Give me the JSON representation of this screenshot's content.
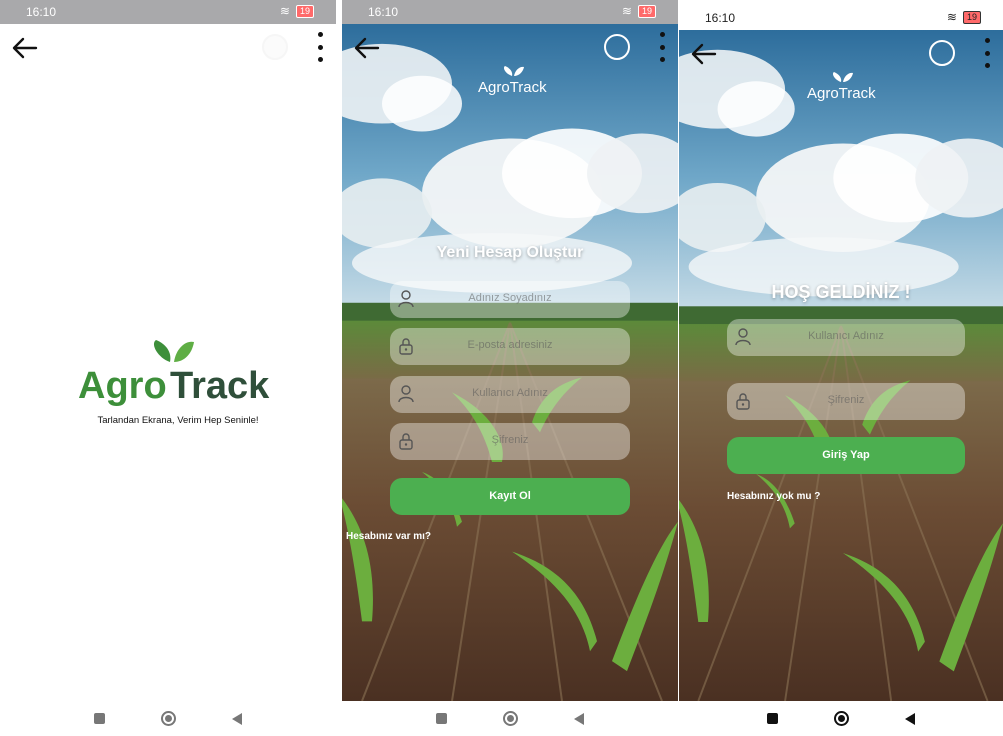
{
  "screens": [
    {
      "status": {
        "time": "16:10",
        "battery": "19"
      },
      "logo_text": "AgroTrack",
      "tagline": "Tarlandan Ekrana, Verim Hep Seninle!"
    },
    {
      "status": {
        "time": "16:10",
        "battery": "19"
      },
      "logo_text": "AgroTrack",
      "title": "Yeni Hesap Oluştur",
      "fields": [
        {
          "placeholder": "Adınız Soyadınız",
          "icon": "user-icon"
        },
        {
          "placeholder": "E-posta adresiniz",
          "icon": "lock-icon"
        },
        {
          "placeholder": "Kullanıcı Adınız",
          "icon": "user-icon"
        },
        {
          "placeholder": "Şifreniz",
          "icon": "lock-icon"
        }
      ],
      "button": "Kayıt Ol",
      "link": "Hesabınız var mı?"
    },
    {
      "status": {
        "time": "16:10",
        "battery": "19"
      },
      "logo_text": "AgroTrack",
      "title": "HOŞ GELDİNİZ !",
      "fields": [
        {
          "placeholder": "Kullanıcı Adınız",
          "icon": "user-icon"
        },
        {
          "placeholder": "Şifreniz",
          "icon": "lock-icon"
        }
      ],
      "button": "Giriş Yap",
      "link": "Hesabınız yok mu ?"
    }
  ],
  "colors": {
    "brand_green": "#4caf50",
    "logo_green": "#3d8f3a",
    "logo_dark": "#2f4f3a"
  }
}
